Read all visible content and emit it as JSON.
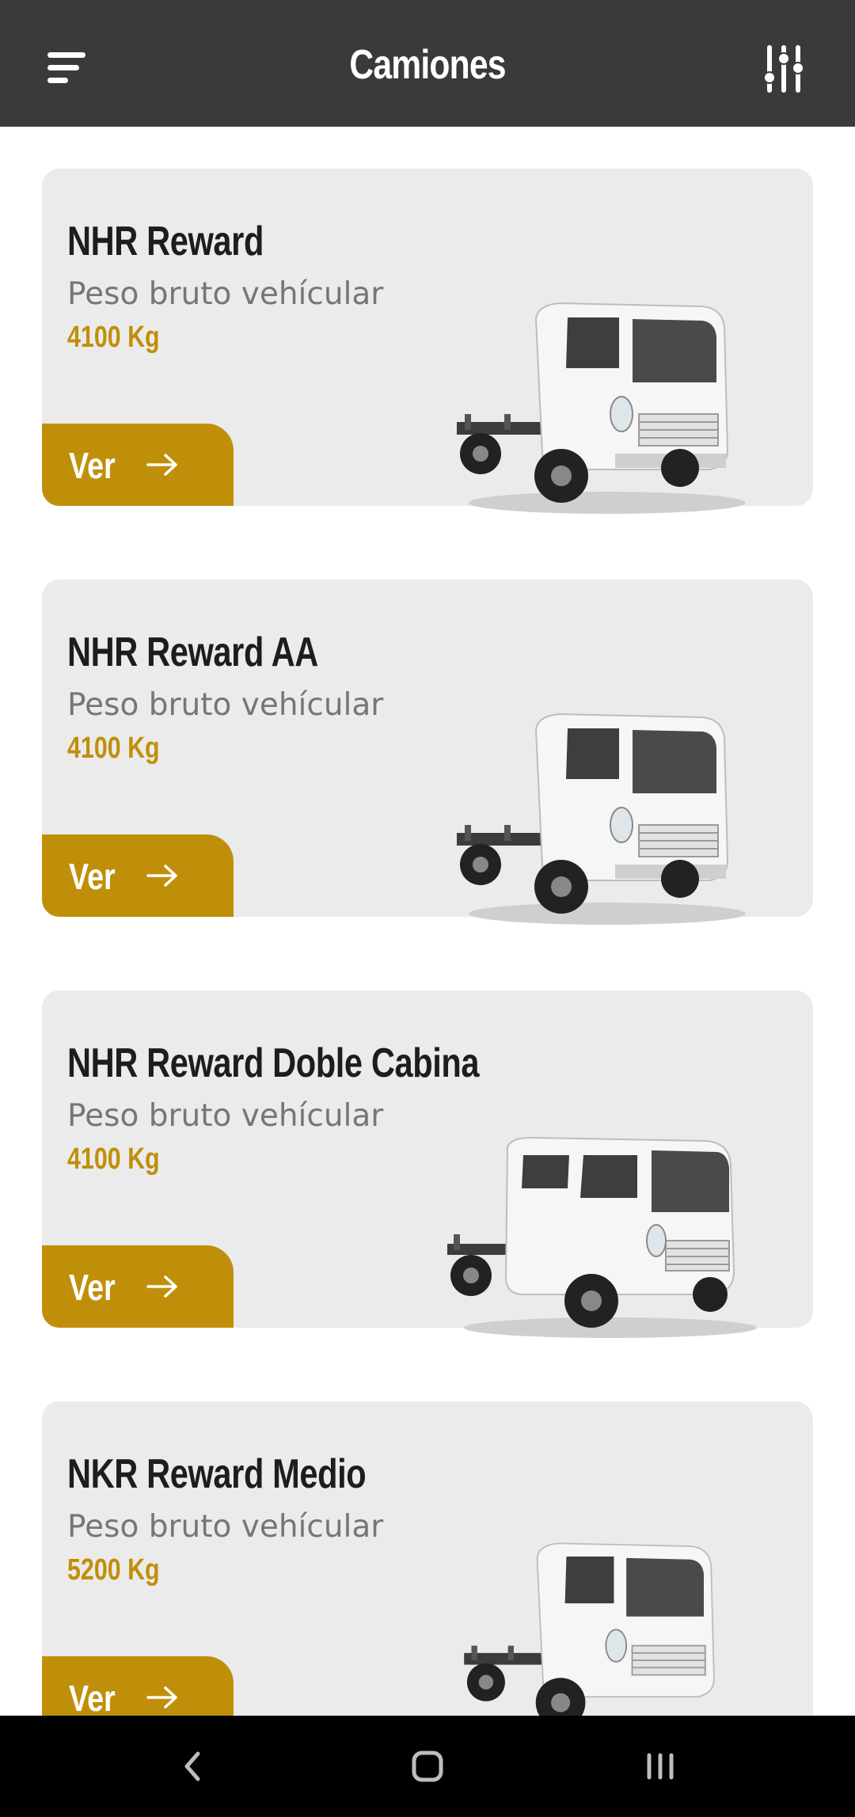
{
  "header": {
    "title": "Camiones",
    "menu_icon": "menu-icon",
    "filter_icon": "sliders-icon"
  },
  "colors": {
    "header_bg": "#3a3a3a",
    "accent": "#c08f0a",
    "card_bg": "#ebebeb",
    "nav_bg": "#000000"
  },
  "trucks": [
    {
      "name": "NHR Reward",
      "weight_label": "Peso bruto vehícular",
      "weight": "4100 Kg",
      "button": "Ver",
      "image": "single-cab-truck-image"
    },
    {
      "name": "NHR Reward AA",
      "weight_label": "Peso bruto vehícular",
      "weight": "4100 Kg",
      "button": "Ver",
      "image": "single-cab-truck-image"
    },
    {
      "name": "NHR Reward Doble Cabina",
      "weight_label": "Peso bruto vehícular",
      "weight": "4100 Kg",
      "button": "Ver",
      "image": "double-cab-truck-image"
    },
    {
      "name": "NKR Reward Medio",
      "weight_label": "Peso bruto vehícular",
      "weight": "5200 Kg",
      "button": "Ver",
      "image": "single-cab-truck-image"
    }
  ],
  "system_nav": {
    "back_icon": "back-icon",
    "home_icon": "home-icon",
    "recents_icon": "recents-icon"
  }
}
